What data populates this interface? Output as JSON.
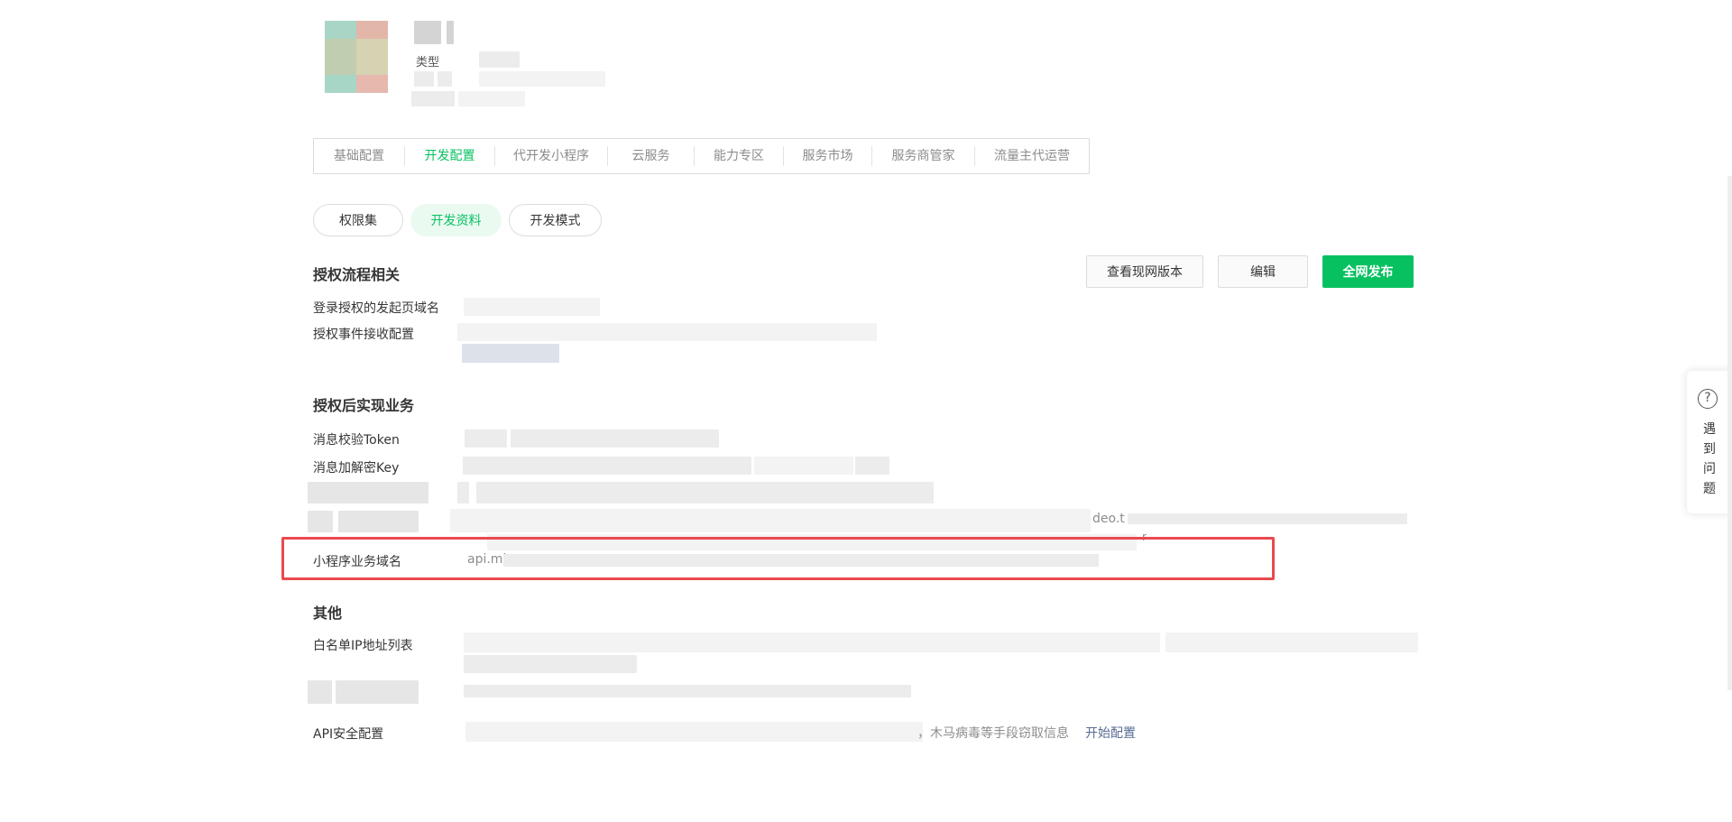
{
  "header": {
    "type_label": "类型"
  },
  "tabs": [
    {
      "label": "基础配置",
      "active": false
    },
    {
      "label": "开发配置",
      "active": true
    },
    {
      "label": "代开发小程序",
      "active": false
    },
    {
      "label": "云服务",
      "active": false
    },
    {
      "label": "能力专区",
      "active": false
    },
    {
      "label": "服务市场",
      "active": false
    },
    {
      "label": "服务商管家",
      "active": false
    },
    {
      "label": "流量主代运营",
      "active": false
    }
  ],
  "subtabs": [
    {
      "label": "权限集",
      "active": false
    },
    {
      "label": "开发资料",
      "active": true
    },
    {
      "label": "开发模式",
      "active": false
    }
  ],
  "actions": {
    "view_live": "查看现网版本",
    "edit": "编辑",
    "publish": "全网发布"
  },
  "sections": {
    "auth_flow": {
      "title": "授权流程相关",
      "login_domain_label": "登录授权的发起页域名",
      "event_config_label": "授权事件接收配置"
    },
    "post_auth": {
      "title": "授权后实现业务",
      "token_label": "消息校验Token",
      "key_label": "消息加解密Key",
      "partial_domain_text": "deo.t",
      "partial_suffix": "r",
      "miniapp_domain_label": "小程序业务域名",
      "miniapp_domain_value": "api.mi"
    },
    "other": {
      "title": "其他",
      "whitelist_label": "白名单IP地址列表",
      "api_security_label": "API安全配置",
      "api_security_text": "，木马病毒等手段窃取信息",
      "api_security_link": "开始配置"
    }
  },
  "help": {
    "icon": "question-icon",
    "text": "遇到问题"
  },
  "colors": {
    "accent": "#07c160",
    "highlight": "#e94a4f",
    "link": "#576b95"
  }
}
